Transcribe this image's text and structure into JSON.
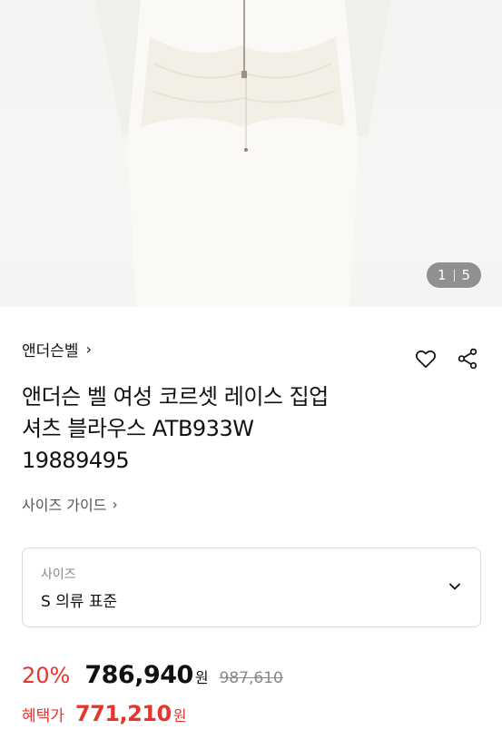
{
  "gallery": {
    "current": "1",
    "total": "5"
  },
  "brand": {
    "name": "앤더슨벨",
    "chevron": "›"
  },
  "icons": {
    "wishlist": "heart-icon",
    "share": "share-icon"
  },
  "product": {
    "title_line1": "앤더슨 벨 여성 코르셋 레이스 집업",
    "title_line2": "셔츠 블라우스 ATB933W",
    "title_line3": "19889495"
  },
  "size_guide": {
    "label": "사이즈 가이드",
    "chevron": "›"
  },
  "size_select": {
    "label": "사이즈",
    "value": "S 의류 표준"
  },
  "pricing": {
    "discount": "20%",
    "price": "786,940",
    "unit": "원",
    "original": "987,610"
  },
  "benefit": {
    "label": "혜택가",
    "price": "771,210",
    "unit": "원"
  },
  "colors": {
    "accent_red": "#e8342d",
    "border": "#dadada"
  }
}
